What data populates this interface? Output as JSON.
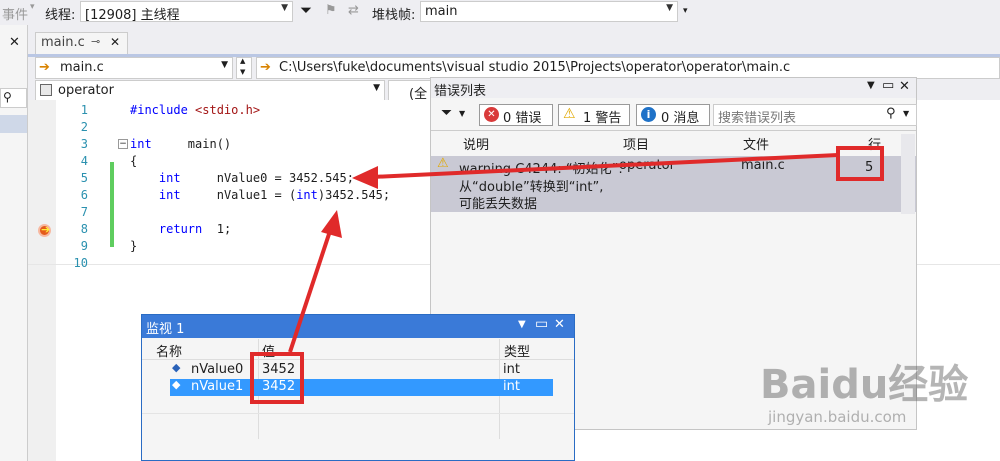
{
  "toolbar": {
    "event_label": "事件",
    "thread_label": "线程:",
    "thread_value": "[12908] 主线程",
    "stack_label": "堆栈帧:",
    "stack_value": "main"
  },
  "doc_tab": {
    "label": "main.c",
    "pin": "⊸",
    "close": "✕"
  },
  "left_close": "✕",
  "nav": {
    "file": "main.c",
    "path": "C:\\Users\\fuke\\documents\\visual studio 2015\\Projects\\operator\\operator\\main.c",
    "scope": "operator",
    "scope2": "(全"
  },
  "code_lines": [
    {
      "n": "1",
      "text": "#include <stdio.h>"
    },
    {
      "n": "2",
      "text": ""
    },
    {
      "n": "3",
      "text": "int     main()"
    },
    {
      "n": "4",
      "text": "{"
    },
    {
      "n": "5",
      "text": "    int     nValue0 = 3452.545;"
    },
    {
      "n": "6",
      "text": "    int     nValue1 = (int)3452.545;"
    },
    {
      "n": "7",
      "text": ""
    },
    {
      "n": "8",
      "text": "    return  1;"
    },
    {
      "n": "9",
      "text": "}"
    },
    {
      "n": "10",
      "text": ""
    }
  ],
  "error_list": {
    "title": "错误列表",
    "errors_btn": "0 错误",
    "warnings_btn": "1 警告",
    "messages_btn": "0 消息",
    "search_placeholder": "搜索错误列表",
    "columns": {
      "desc": "说明",
      "project": "项目",
      "file": "文件",
      "line": "行"
    },
    "row": {
      "desc_line1": "warning C4244: “初始化”:",
      "desc_line2": "从“double”转换到“int”,",
      "desc_line3": "可能丢失数据",
      "project": "operator",
      "file": "main.c",
      "line": "5"
    }
  },
  "watch": {
    "title": "监视 1",
    "columns": {
      "name": "名称",
      "value": "值",
      "type": "类型"
    },
    "rows": [
      {
        "name": "nValue0",
        "value": "3452",
        "type": "int"
      },
      {
        "name": "nValue1",
        "value": "3452",
        "type": "int"
      }
    ]
  },
  "watermark": {
    "brand": "Baidu经验",
    "url": "jingyan.baidu.com"
  },
  "colors": {
    "accent": "#3a7ad8",
    "annotation": "#e02a2a",
    "selection": "#3399ff"
  }
}
